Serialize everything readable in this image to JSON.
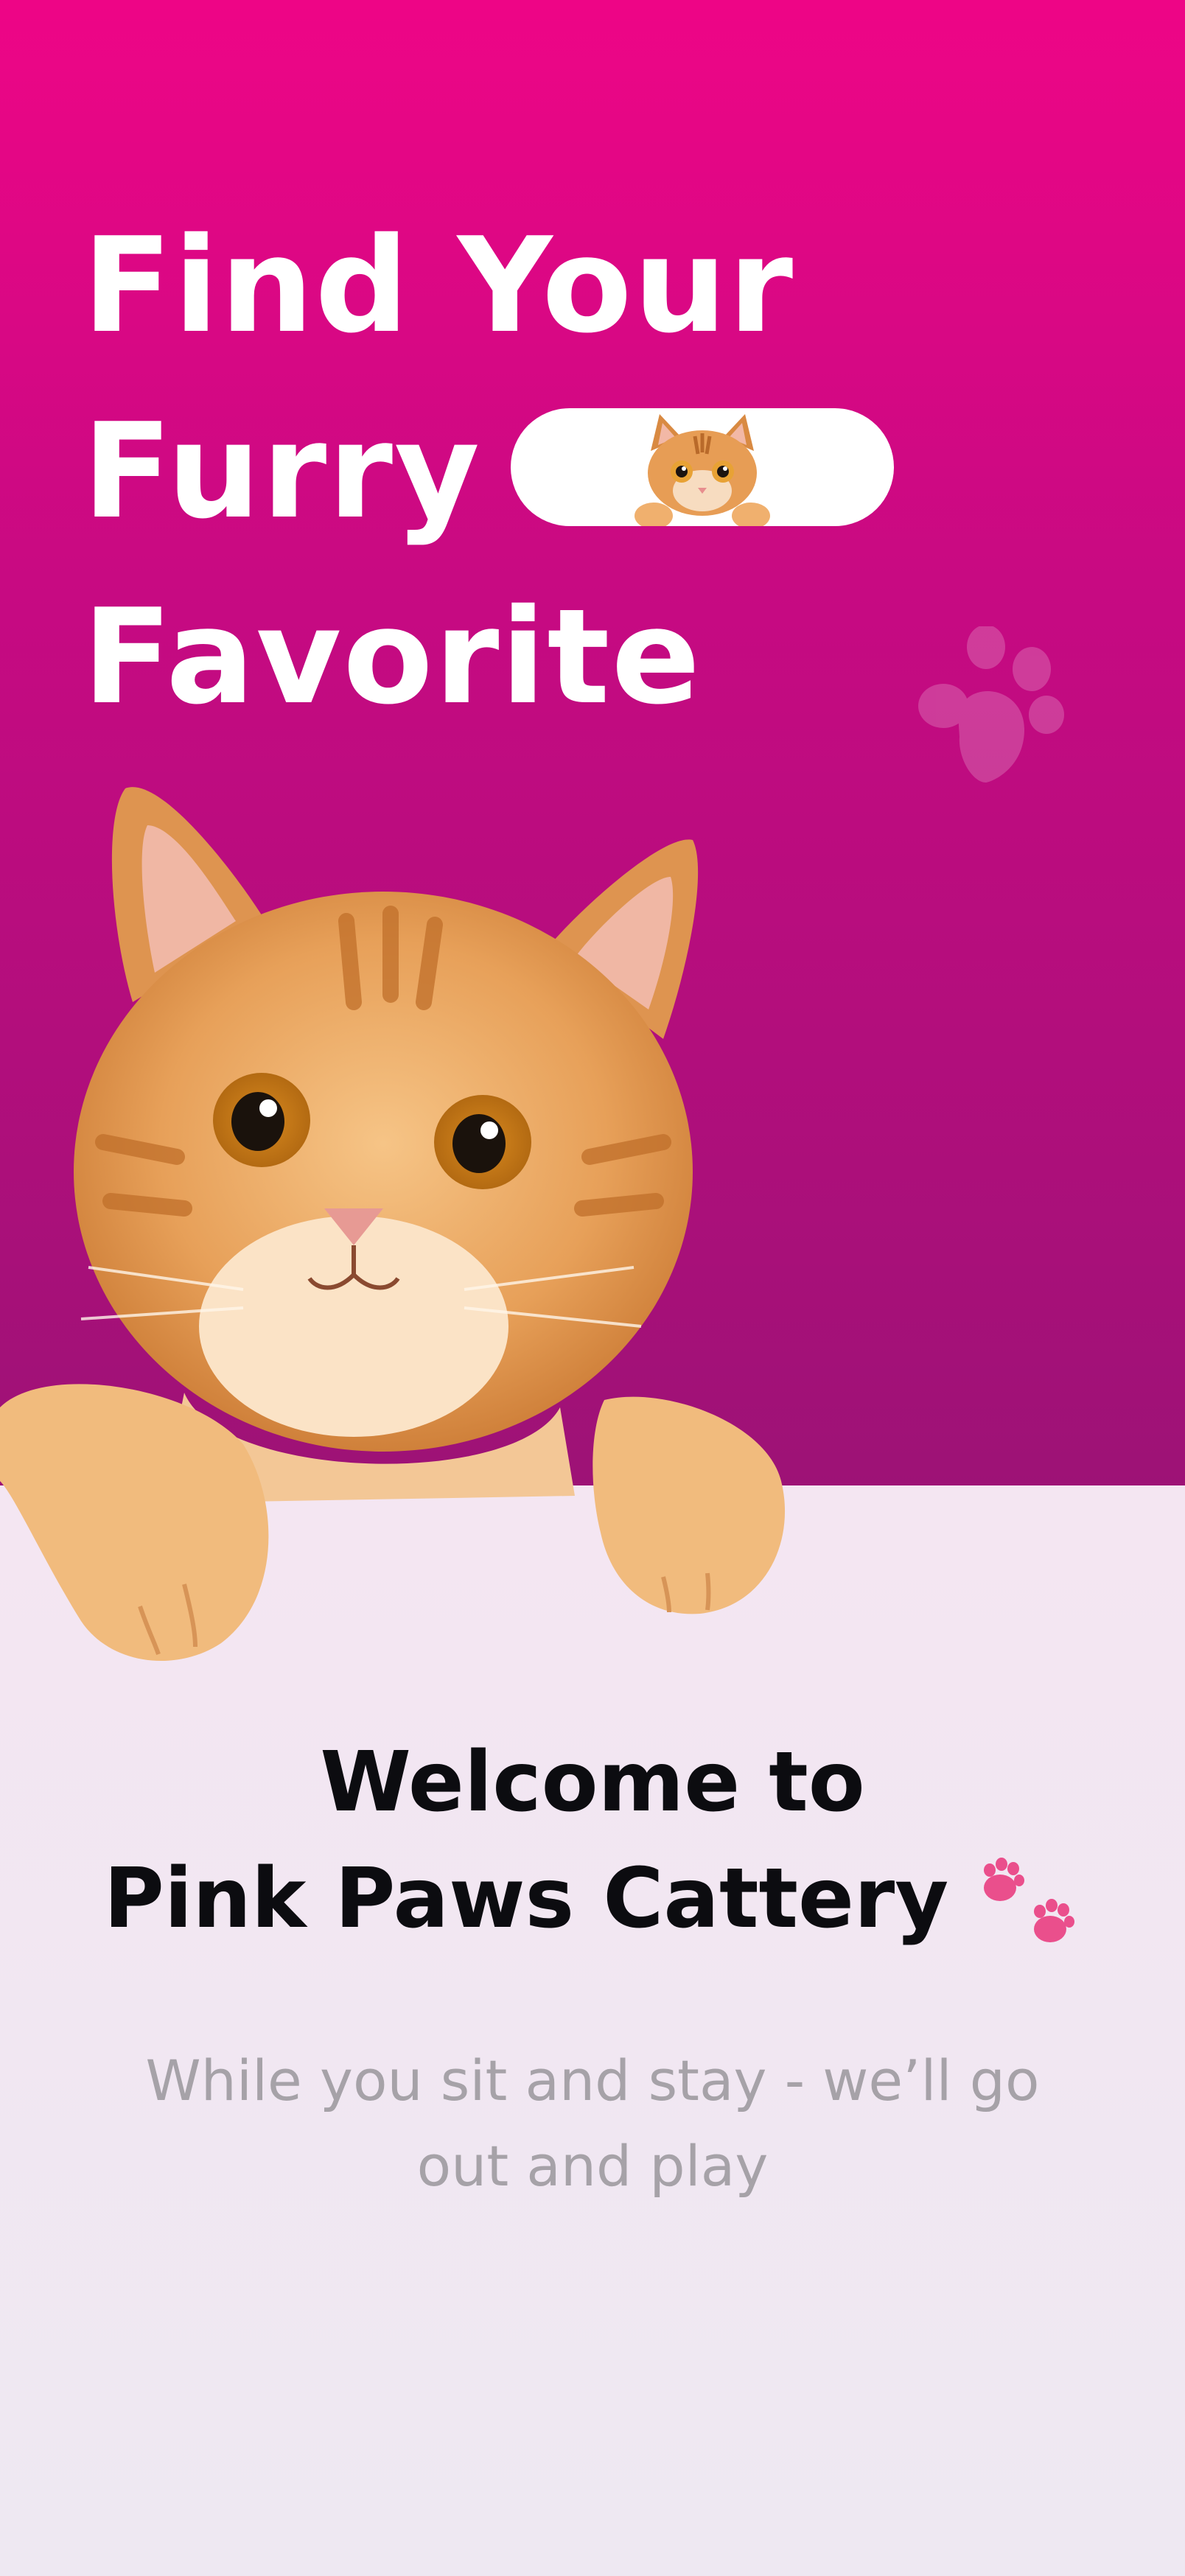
{
  "hero": {
    "title_line1": "Find Your",
    "title_line2": "Furry",
    "title_line3": "Favorite"
  },
  "welcome": {
    "line1": "Welcome to",
    "line2": "Pink Paws Cattery"
  },
  "tagline": "While you sit and stay - we’ll go out and play",
  "colors": {
    "hero_top": "#ee0586",
    "hero_bottom": "#9d1276",
    "background": "#f0e6f0",
    "paw_accent": "#ea4f8c",
    "tagline": "#a6a2a8"
  },
  "icons": [
    "cat-thumbnail-icon",
    "paw-print-decor-icon",
    "paw-prints-icon"
  ],
  "images": [
    "orange-tabby-cat-hero-image"
  ]
}
